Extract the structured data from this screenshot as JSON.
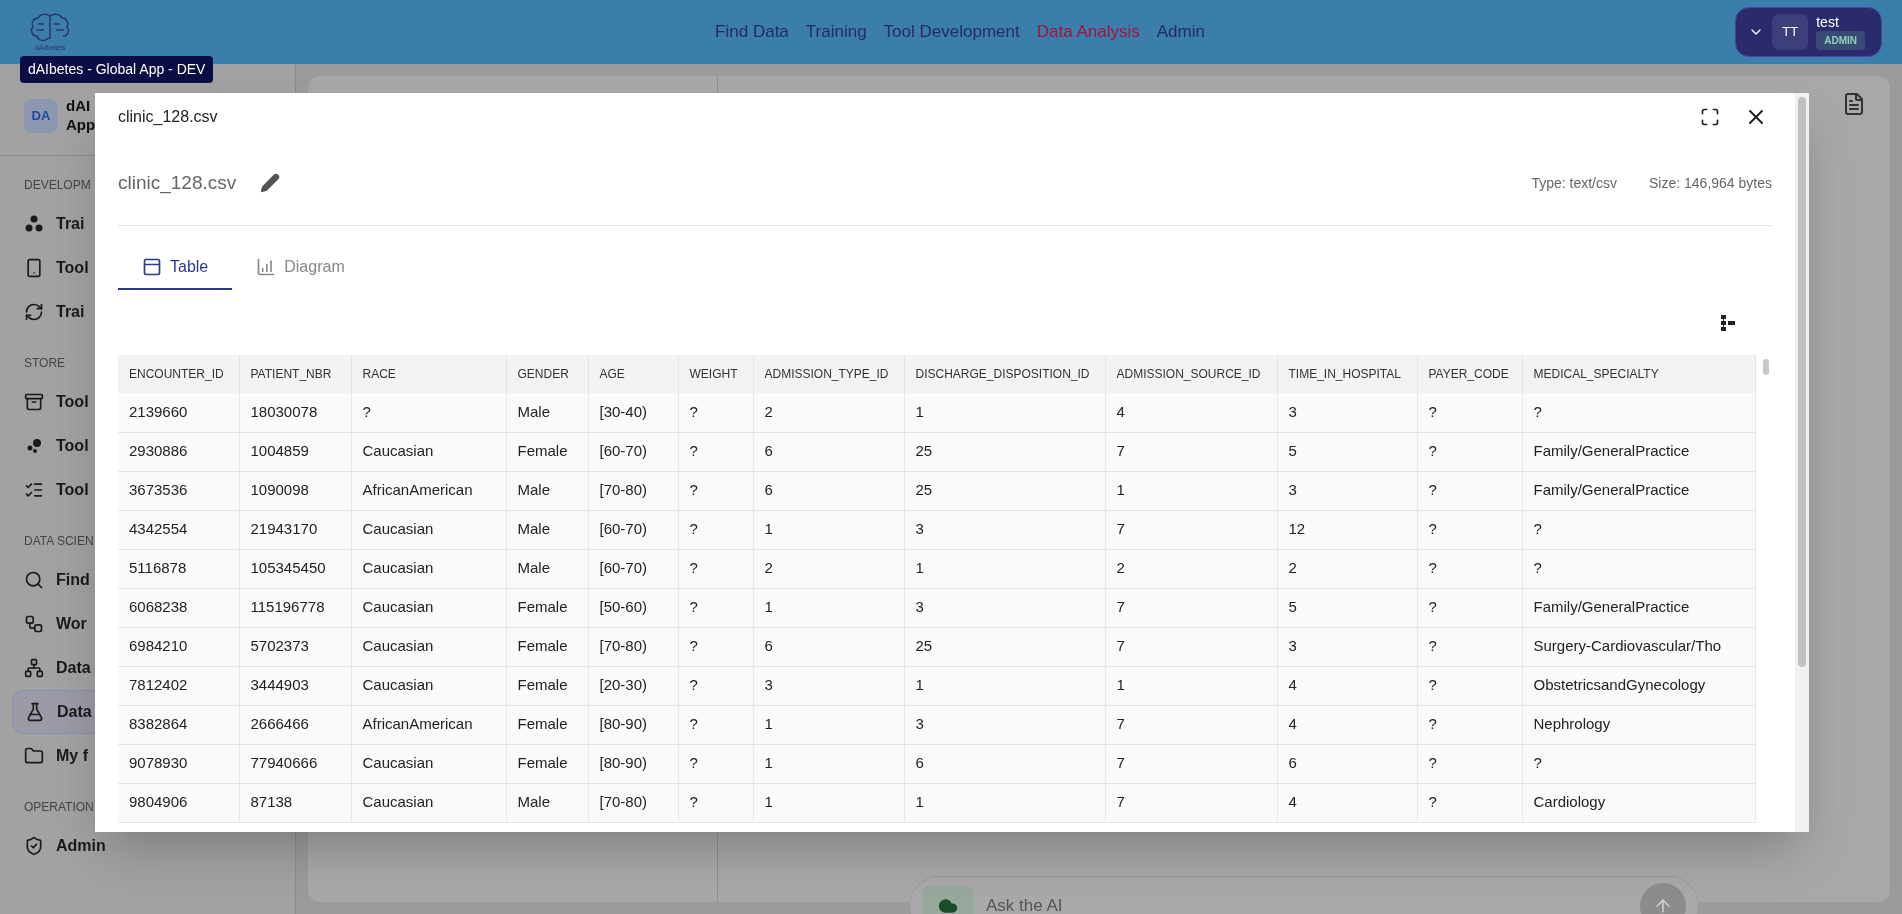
{
  "header": {
    "logo_text": "dAlbetes",
    "nav": [
      {
        "label": "Find Data",
        "selected": false
      },
      {
        "label": "Training",
        "selected": false
      },
      {
        "label": "Tool Development",
        "selected": false
      },
      {
        "label": "Data Analysis",
        "selected": true
      },
      {
        "label": "Admin",
        "selected": false
      }
    ],
    "user": {
      "initials": "TT",
      "name": "test",
      "role": "ADMIN"
    }
  },
  "tooltip": "dAIbetes - Global App - DEV",
  "sidebar": {
    "workspace": {
      "initials": "DA",
      "title_lines": [
        "dAI",
        "App"
      ]
    },
    "sections": [
      {
        "title": "DEVELOPM",
        "items": [
          {
            "label": "Trai",
            "selected": false
          },
          {
            "label": "Tool",
            "selected": false
          },
          {
            "label": "Trai",
            "selected": false
          }
        ]
      },
      {
        "title": "STORE",
        "items": [
          {
            "label": "Tool",
            "selected": false
          },
          {
            "label": "Tool",
            "selected": false
          },
          {
            "label": "Tool",
            "selected": false
          }
        ]
      },
      {
        "title": "DATA SCIEN",
        "items": [
          {
            "label": "Find",
            "selected": false
          },
          {
            "label": "Wor",
            "selected": false
          },
          {
            "label": "Data",
            "selected": false
          },
          {
            "label": "Data",
            "selected": true
          },
          {
            "label": "My f",
            "selected": false
          }
        ]
      },
      {
        "title": "OPERATION",
        "items": [
          {
            "label": "Admin",
            "selected": false
          }
        ]
      }
    ]
  },
  "chat": {
    "placeholder": "Ask the AI"
  },
  "modal": {
    "title": "clinic_128.csv",
    "file_name": "clinic_128.csv",
    "type": "Type: text/csv",
    "size": "Size: 146,964 bytes",
    "tabs": [
      {
        "label": "Table",
        "selected": true
      },
      {
        "label": "Diagram",
        "selected": false
      }
    ],
    "table": {
      "columns": [
        "ENCOUNTER_ID",
        "PATIENT_NBR",
        "RACE",
        "GENDER",
        "AGE",
        "WEIGHT",
        "ADMISSION_TYPE_ID",
        "DISCHARGE_DISPOSITION_ID",
        "ADMISSION_SOURCE_ID",
        "TIME_IN_HOSPITAL",
        "PAYER_CODE",
        "MEDICAL_SPECIALTY"
      ],
      "rows": [
        [
          "2139660",
          "18030078",
          "?",
          "Male",
          "[30-40)",
          "?",
          "2",
          "1",
          "4",
          "3",
          "?",
          "?"
        ],
        [
          "2930886",
          "1004859",
          "Caucasian",
          "Female",
          "[60-70)",
          "?",
          "6",
          "25",
          "7",
          "5",
          "?",
          "Family/GeneralPractice"
        ],
        [
          "3673536",
          "1090098",
          "AfricanAmerican",
          "Male",
          "[70-80)",
          "?",
          "6",
          "25",
          "1",
          "3",
          "?",
          "Family/GeneralPractice"
        ],
        [
          "4342554",
          "21943170",
          "Caucasian",
          "Male",
          "[60-70)",
          "?",
          "1",
          "3",
          "7",
          "12",
          "?",
          "?"
        ],
        [
          "5116878",
          "105345450",
          "Caucasian",
          "Male",
          "[60-70)",
          "?",
          "2",
          "1",
          "2",
          "2",
          "?",
          "?"
        ],
        [
          "6068238",
          "115196778",
          "Caucasian",
          "Female",
          "[50-60)",
          "?",
          "1",
          "3",
          "7",
          "5",
          "?",
          "Family/GeneralPractice"
        ],
        [
          "6984210",
          "5702373",
          "Caucasian",
          "Female",
          "[70-80)",
          "?",
          "6",
          "25",
          "7",
          "3",
          "?",
          "Surgery-Cardiovascular/Tho"
        ],
        [
          "7812402",
          "3444903",
          "Caucasian",
          "Female",
          "[20-30)",
          "?",
          "3",
          "1",
          "1",
          "4",
          "?",
          "ObstetricsandGynecology"
        ],
        [
          "8382864",
          "2666466",
          "AfricanAmerican",
          "Female",
          "[80-90)",
          "?",
          "1",
          "3",
          "7",
          "4",
          "?",
          "Nephrology"
        ],
        [
          "9078930",
          "77940666",
          "Caucasian",
          "Female",
          "[80-90)",
          "?",
          "1",
          "6",
          "7",
          "6",
          "?",
          "?"
        ],
        [
          "9804906",
          "87138",
          "Caucasian",
          "Male",
          "[70-80)",
          "?",
          "1",
          "1",
          "7",
          "4",
          "?",
          "Cardiology"
        ]
      ]
    }
  }
}
